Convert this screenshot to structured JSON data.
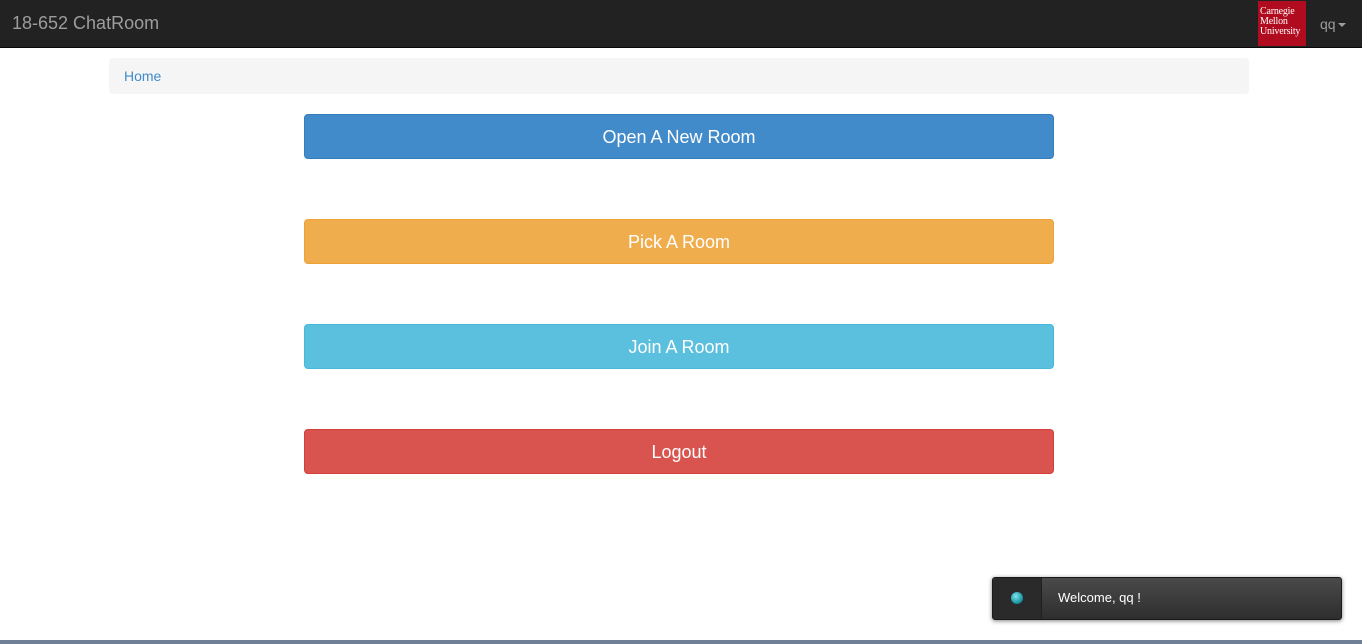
{
  "navbar": {
    "brand": "18-652 ChatRoom",
    "logo_lines": [
      "Carnegie",
      "Mellon",
      "University"
    ],
    "user": "qq"
  },
  "breadcrumb": {
    "home": "Home"
  },
  "actions": {
    "open_room": "Open A New Room",
    "pick_room": "Pick A Room",
    "join_room": "Join A Room",
    "logout": "Logout"
  },
  "notification": {
    "message": "Welcome, qq !"
  },
  "colors": {
    "primary": "#428bca",
    "warning": "#f0ad4e",
    "info": "#5bc0de",
    "danger": "#d9534f",
    "navbar": "#222222",
    "logo": "#b00b1e"
  }
}
